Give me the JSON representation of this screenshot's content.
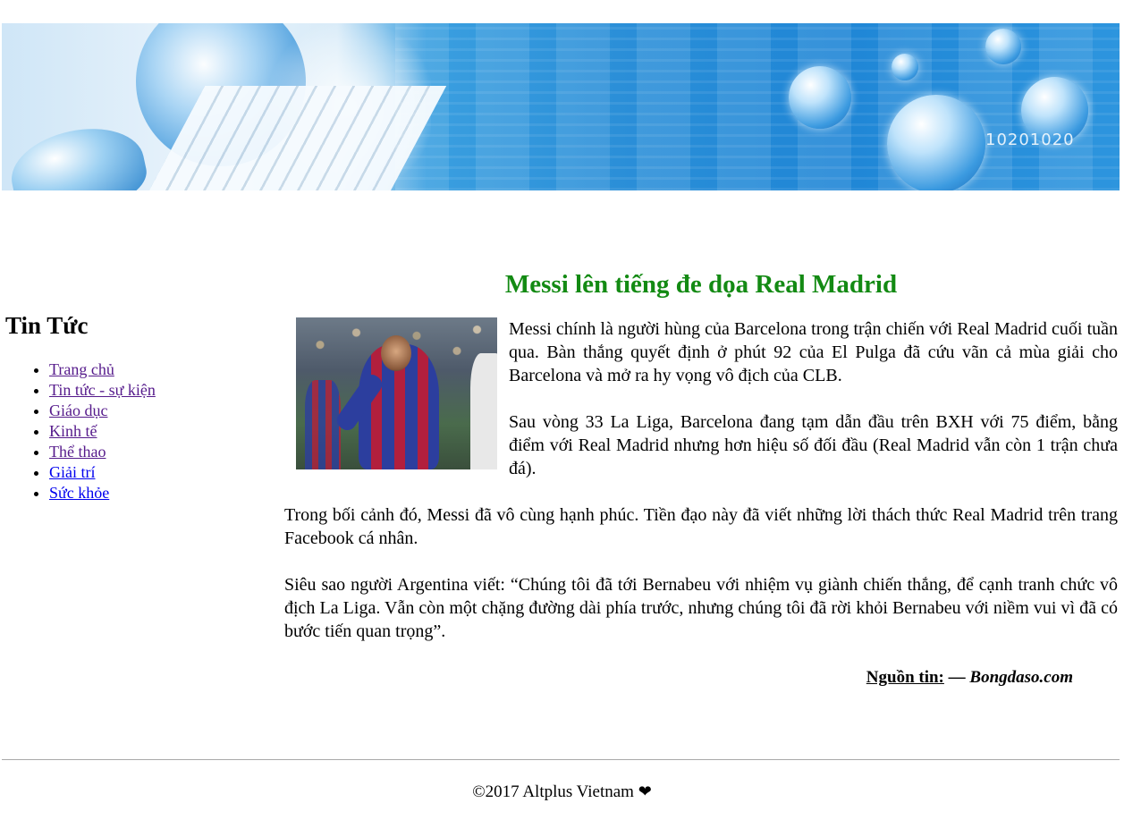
{
  "banner": {
    "digits": "10201020"
  },
  "sidebar": {
    "title": "Tin Tức",
    "items": [
      {
        "label": "Trang chủ",
        "visited": true
      },
      {
        "label": "Tin tức - sự kiện",
        "visited": true
      },
      {
        "label": "Giáo dục",
        "visited": true
      },
      {
        "label": "Kinh tế",
        "visited": true
      },
      {
        "label": "Thể thao",
        "visited": true
      },
      {
        "label": "Giải trí",
        "visited": false
      },
      {
        "label": "Sức khỏe",
        "visited": false
      }
    ]
  },
  "article": {
    "title": "Messi lên tiếng đe dọa Real Madrid",
    "paragraphs": [
      "Messi chính là người hùng của Barcelona trong trận chiến với Real Madrid cuối tuần qua. Bàn thắng quyết định ở phút 92 của El Pulga đã cứu vãn cả mùa giải cho Barcelona và mở ra hy vọng vô địch của CLB.",
      "Sau vòng 33 La Liga, Barcelona đang tạm dẫn đầu trên BXH với 75 điểm, bằng điểm với Real Madrid nhưng hơn hiệu số đối đầu (Real Madrid vẫn còn 1 trận chưa đá).",
      "Trong bối cảnh đó, Messi đã vô cùng hạnh phúc. Tiền đạo này đã viết những lời thách thức Real Madrid trên trang Facebook cá nhân.",
      "Siêu sao người Argentina viết: “Chúng tôi đã tới Bernabeu với nhiệm vụ giành chiến thắng, để cạnh tranh chức vô địch La Liga. Vẫn còn một chặng đường dài phía trước, nhưng chúng tôi đã rời khỏi Bernabeu với niềm vui vì đã có bước tiến quan trọng”."
    ],
    "source_label": "Nguồn tin:",
    "source_dash": " — ",
    "source_site": "Bongdaso.com"
  },
  "footer": {
    "copyright": "©2017 Altplus Vietnam",
    "heart": "❤"
  },
  "colors": {
    "title_green": "#138a13",
    "link_visited": "#551a8b",
    "link_unvisited": "#0000ee"
  }
}
